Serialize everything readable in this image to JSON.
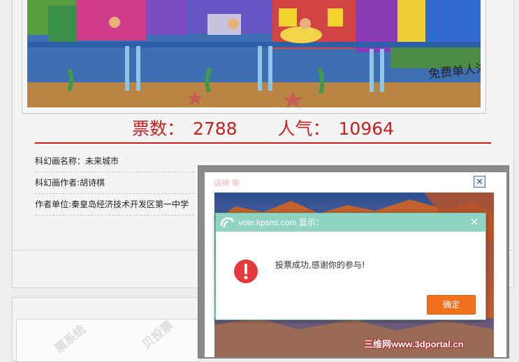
{
  "stats": {
    "votes_label": "票数：",
    "votes": "2788",
    "popularity_label": "人气：",
    "popularity": "10964"
  },
  "info": {
    "rows": [
      {
        "label": "科幻画名称：",
        "value": "未来城市"
      },
      {
        "label": "科幻画作者:",
        "value": "胡诗棋"
      },
      {
        "label": "作者单位:",
        "value": "秦皇岛经济技术开发区第一中学"
      }
    ]
  },
  "watermarks": [
    "票系统",
    "贝投票"
  ],
  "overlay": {
    "close_symbol": "×",
    "faint_title": "请稍 等"
  },
  "dialog": {
    "title": "vote.kpsns.com 显示：",
    "close_symbol": "×",
    "message": "投票成功,感谢你的参与!",
    "ok_label": "确定"
  },
  "footer": {
    "watermark": "三维网www.3dportal.cn"
  },
  "colors": {
    "accent_red": "#c81f1f",
    "dialog_bar": "#8fd3c2",
    "ok_orange": "#f1701c"
  }
}
